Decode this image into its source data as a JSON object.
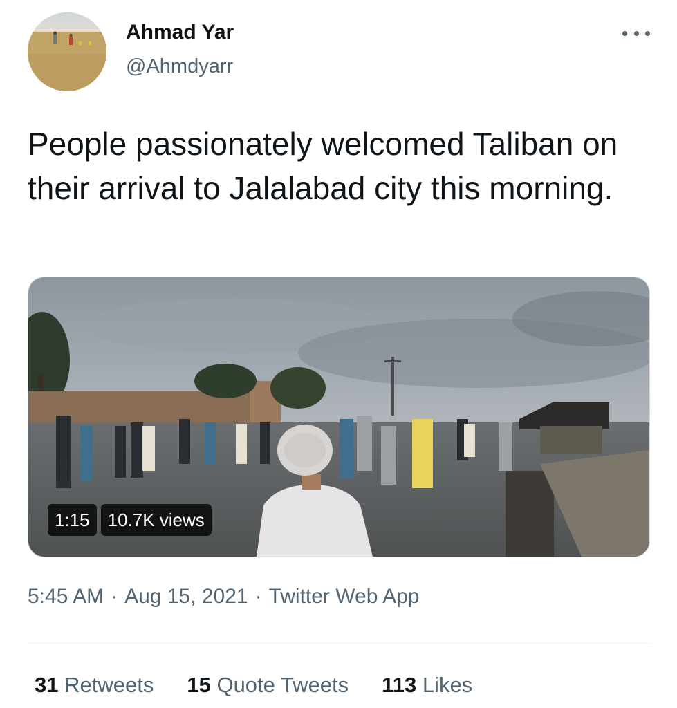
{
  "author": {
    "name": "Ahmad Yar",
    "handle": "@Ahmdyarr"
  },
  "tweet": {
    "text": "People passionately welcomed Taliban on their arrival to Jalalabad city this morning."
  },
  "video": {
    "duration": "1:15",
    "views": "10.7K views"
  },
  "meta": {
    "time": "5:45 AM",
    "date": "Aug 15, 2021",
    "source": "Twitter Web App",
    "separator": "·"
  },
  "stats": {
    "retweets_count": "31",
    "retweets_label": "Retweets",
    "quotes_count": "15",
    "quotes_label": "Quote Tweets",
    "likes_count": "113",
    "likes_label": "Likes"
  },
  "colors": {
    "text_primary": "#0f1419",
    "text_secondary": "#536471",
    "divider": "#eff3f4"
  },
  "icons": {
    "more": "more-horizontal-icon"
  }
}
